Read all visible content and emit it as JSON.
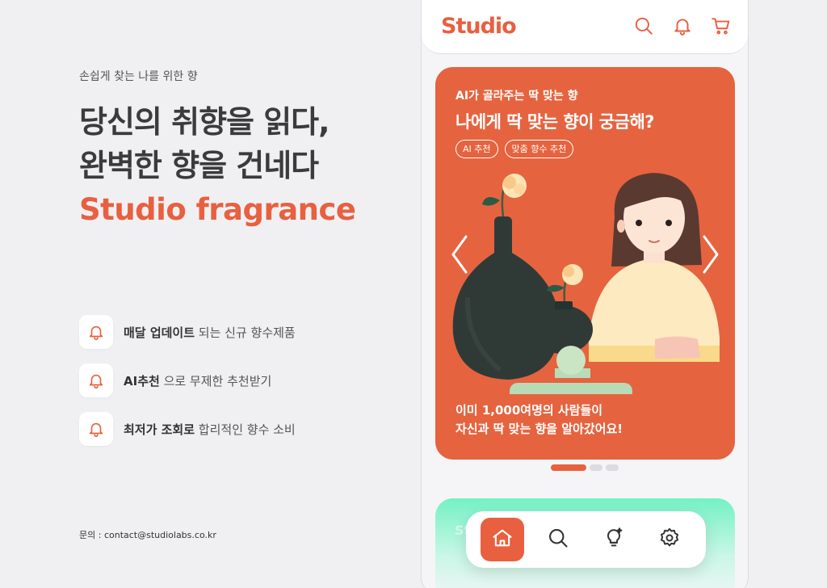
{
  "promo": {
    "tagline": "손쉽게 찾는 나를 위한 향",
    "headline_line1": "당신의 취향을 읽다,",
    "headline_line2": "완벽한 향을 건네다",
    "brand": "Studio fragrance",
    "features": [
      {
        "icon": "bell-icon",
        "bold": "매달 업데이트",
        "rest": " 되는 신규 향수제품"
      },
      {
        "icon": "bell-icon",
        "bold": "AI추천",
        "rest": " 으로 무제한 추천받기"
      },
      {
        "icon": "bell-icon",
        "bold": "최저가 조회로",
        "rest": " 합리적인 향수 소비"
      }
    ],
    "contact": "문의 : contact@studiolabs.co.kr"
  },
  "app": {
    "logo": "Studio",
    "header_icons": [
      "search-icon",
      "bell-icon",
      "cart-icon"
    ],
    "banner": {
      "subtitle": "AI가 골라주는 딱 맞는 향",
      "title": "나에게 딱 맞는 향이 궁금해?",
      "chips": [
        "AI 추천",
        "맞춤 향수 추천"
      ],
      "footer_line1": "이미 1,000여명의 사람들이",
      "footer_line2": "자신과 딱 맞는 향을 알아갔어요!",
      "prev_icon": "chevron-left-icon",
      "next_icon": "chevron-right-icon"
    },
    "carousel_pages": 3,
    "carousel_active": 1,
    "next_card_peek": "St",
    "bottom_nav": [
      "home-icon",
      "search-icon",
      "lightbulb-icon",
      "gear-icon"
    ],
    "bottom_nav_active": "home-icon"
  },
  "colors": {
    "accent": "#e8603f",
    "banner": "#e6633f",
    "background": "#f0f0f3",
    "mint": "#74f1c4"
  }
}
